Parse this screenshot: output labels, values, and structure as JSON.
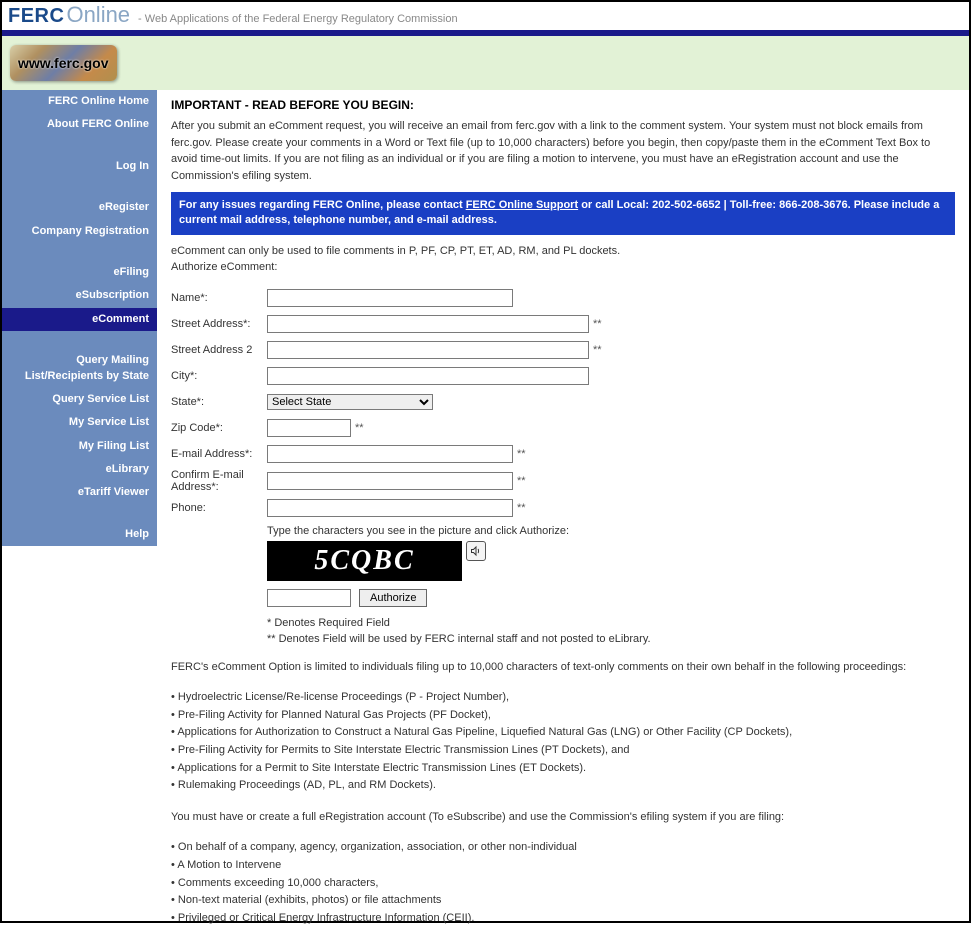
{
  "header": {
    "brand1": "FERC",
    "brand2": "Online",
    "tagline": "- Web Applications of the Federal Energy Regulatory Commission",
    "logo_text": "www.ferc.gov"
  },
  "sidebar": {
    "home": "FERC Online Home",
    "about": "About FERC Online",
    "login": "Log In",
    "eregister": "eRegister",
    "company_reg": "Company Registration",
    "efiling": "eFiling",
    "esubscription": "eSubscription",
    "ecomment": "eComment",
    "query_mailing": "Query Mailing List/Recipients by State",
    "query_service": "Query Service List",
    "my_service": "My Service List",
    "my_filing": "My Filing List",
    "elibrary": "eLibrary",
    "etariff": "eTariff Viewer",
    "help": "Help"
  },
  "main": {
    "important_heading": "IMPORTANT - READ BEFORE YOU BEGIN:",
    "intro": "After you submit an eComment request, you will receive an email from ferc.gov with a link to the comment system. Your system must not block emails from ferc.gov. Please create your comments in a Word or Text file (up to 10,000 characters) before you begin, then copy/paste them in the eComment Text Box to avoid time-out limits. If you are not filing as an individual or if you are filing a motion to intervene, you must have an eRegistration account and use the Commission's efiling system.",
    "support_prefix": "For any issues regarding FERC Online, please contact ",
    "support_link": "FERC Online Support",
    "support_mid": " or call Local: 202-502-6652 | Toll-free: 866-208-3676. Please include a current mail address, telephone number, and e-mail address.",
    "docket_note": "eComment can only be used to file comments in P, PF, CP, PT, ET, AD, RM, and PL dockets.",
    "authorize_label": "Authorize eComment:",
    "form": {
      "name_label": "Name*:",
      "street1_label": "Street Address*:",
      "street2_label": "Street Address 2",
      "city_label": "City*:",
      "state_label": "State*:",
      "state_placeholder": "Select State",
      "zip_label": "Zip Code*:",
      "email_label": "E-mail Address*:",
      "confirm_email_label": "Confirm E-mail Address*:",
      "phone_label": "Phone:",
      "captcha_instr": "Type the characters you see in the picture and click Authorize:",
      "captcha_text": "5CQBC",
      "authorize_btn": "Authorize",
      "star2": "**"
    },
    "denote1": "* Denotes Required Field",
    "denote2": "** Denotes Field will be used by FERC internal staff and not posted to eLibrary.",
    "limited_intro": "FERC's eComment Option is limited to individuals filing up to 10,000 characters of text-only comments on their own behalf in the following proceedings:",
    "proceedings": [
      "Hydroelectric License/Re-license Proceedings (P - Project Number),",
      "Pre-Filing Activity for Planned Natural Gas Projects (PF Docket),",
      "Applications for Authorization to Construct a Natural Gas Pipeline, Liquefied Natural Gas (LNG) or Other Facility (CP Dockets),",
      "Pre-Filing Activity for Permits to Site Interstate Electric Transmission Lines (PT Dockets), and",
      "Applications for a Permit to Site Interstate Electric Transmission Lines (ET Dockets).",
      "Rulemaking Proceedings (AD, PL, and RM Dockets)."
    ],
    "must_have": "You must have or create a full eRegistration account (To eSubscribe) and use the Commission's efiling system if you are filing:",
    "filing_list": [
      "On behalf of a company, agency, organization, association, or other non-individual",
      "A Motion to Intervene",
      "Comments exceeding 10,000 characters,",
      "Non-text material (exhibits, photos) or file attachments",
      "Privileged or Critical Energy Infrastructure Information (CEII)."
    ]
  }
}
